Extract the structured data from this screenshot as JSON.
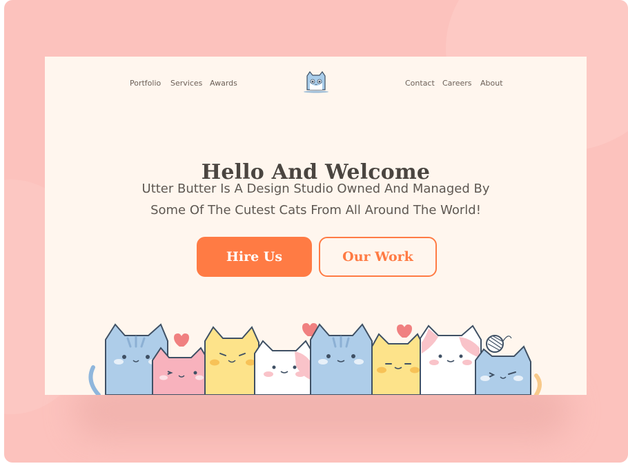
{
  "nav": {
    "left": [
      "Portfolio",
      "Services",
      "Awards"
    ],
    "right": [
      "Contact",
      "Careers",
      "About"
    ]
  },
  "hero": {
    "title": "Hello And Welcome",
    "subtitle_line1": "Utter Butter Is A Design Studio Owned And Managed By",
    "subtitle_line2": "Some Of The Cutest Cats From All Around The World!"
  },
  "buttons": {
    "primary": "Hire Us",
    "secondary": "Our Work"
  },
  "colors": {
    "accent": "#ff7b44",
    "page_bg": "#fff6ee",
    "outer_bg": "#fcc2bd",
    "text": "#4a4540"
  },
  "icons": [
    "cat-logo-icon"
  ]
}
